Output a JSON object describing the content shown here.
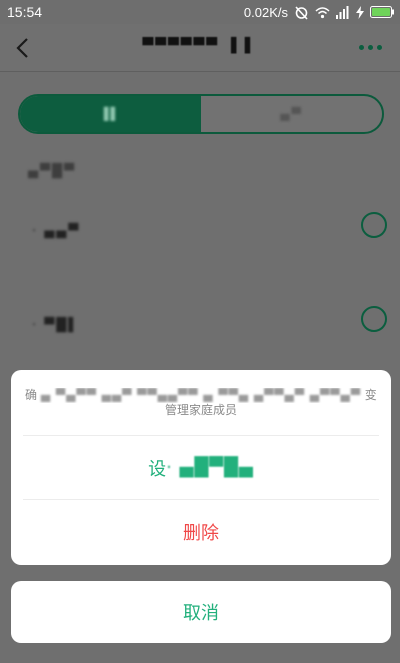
{
  "status_bar": {
    "time": "15:54",
    "network_speed": "0.02K/s",
    "icons": [
      "alarm-off-icon",
      "wifi-icon",
      "signal-icon",
      "charging-icon",
      "battery-icon"
    ]
  },
  "header": {
    "title": "▀▀▀▀▀▀ ▐ ▌",
    "back_icon": "chevron-left-icon",
    "more_icon": "more-dots-icon"
  },
  "segment": {
    "tabs": [
      {
        "label": "▐▌",
        "active": true
      },
      {
        "label": "▄▀",
        "active": false
      }
    ]
  },
  "members": {
    "section_label": "▄▀█▀",
    "rows": [
      {
        "name": "· ▄▄▀"
      },
      {
        "name": "· ▀█▌"
      }
    ]
  },
  "action_sheet": {
    "message_line1_start": "确",
    "message_line1_obfuscated": "▄ ▀▄▀▀ ▄▄▀ ▀▀▄▄▀▀ ▄ ▀▀▄ ▄▀▀▄▀ ▄▀▀▄▀",
    "message_line1_end": "变成",
    "message_line2": "管理家庭成员",
    "set_label_start": "设",
    "set_label_obfuscated": "· ▄█▀█▄",
    "delete_label": "删除"
  },
  "cancel": {
    "label": "取消"
  },
  "colors": {
    "accent_green": "#22b07c",
    "danger_red": "#f04848",
    "dim_overlay": "#6f6f6f"
  }
}
